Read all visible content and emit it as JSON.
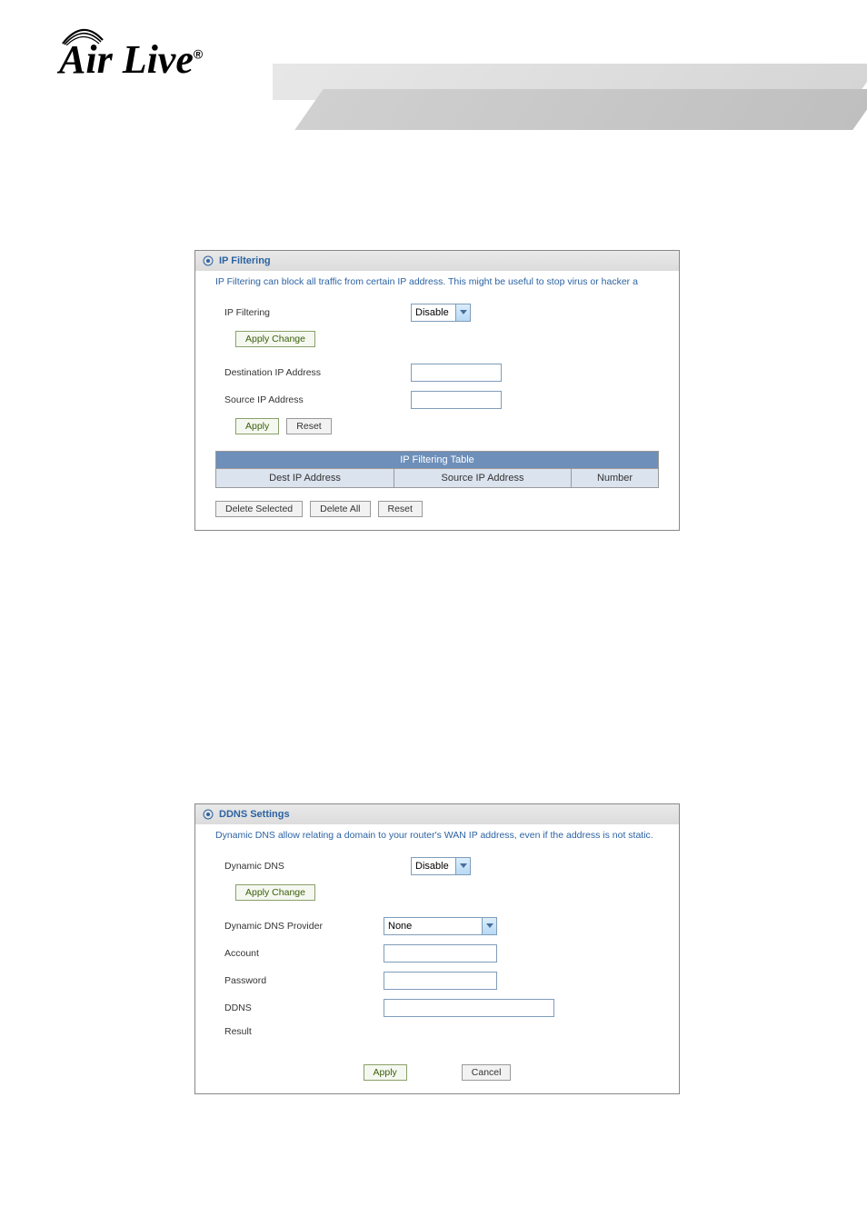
{
  "logo": {
    "brand": "AirLive",
    "registered": "®"
  },
  "ip_filtering": {
    "title": "IP Filtering",
    "desc": "IP Filtering can block all traffic from certain IP address. This might be useful to stop virus or hacker a",
    "label_main": "IP Filtering",
    "select_value": "Disable",
    "apply_change": "Apply Change",
    "dest_label": "Destination IP Address",
    "src_label": "Source IP Address",
    "apply": "Apply",
    "reset": "Reset",
    "table_title": "IP Filtering Table",
    "col_dest": "Dest IP Address",
    "col_src": "Source IP Address",
    "col_num": "Number",
    "delete_selected": "Delete Selected",
    "delete_all": "Delete All",
    "reset2": "Reset"
  },
  "ddns": {
    "title": "DDNS Settings",
    "desc": "Dynamic DNS allow relating a domain to your router's WAN IP address, even if the address is not static.",
    "label_main": "Dynamic DNS",
    "select_value": "Disable",
    "apply_change": "Apply Change",
    "provider_label": "Dynamic DNS Provider",
    "provider_value": "None",
    "account_label": "Account",
    "password_label": "Password",
    "ddns_label": "DDNS",
    "result_label": "Result",
    "apply": "Apply",
    "cancel": "Cancel"
  }
}
